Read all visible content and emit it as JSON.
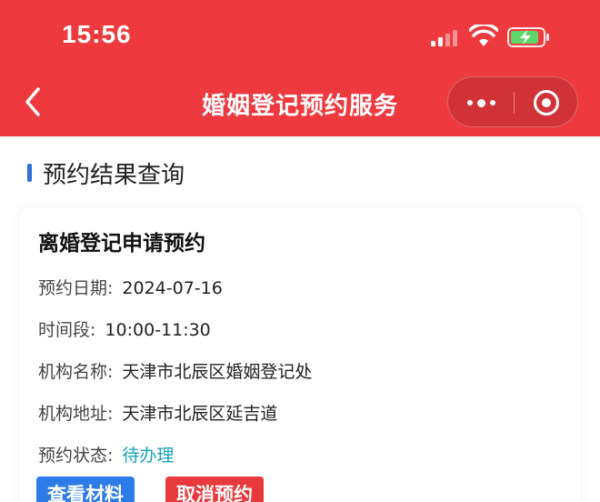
{
  "status_bar": {
    "time": "15:56"
  },
  "nav": {
    "title": "婚姻登记预约服务"
  },
  "section": {
    "title": "预约结果查询"
  },
  "appointment": {
    "title": "离婚登记申请预约",
    "fields": [
      {
        "label": "预约日期:",
        "value": "2024-07-16"
      },
      {
        "label": "时间段:",
        "value": "10:00-11:30"
      },
      {
        "label": "机构名称:",
        "value": "天津市北辰区婚姻登记处"
      },
      {
        "label": "机构地址:",
        "value": "天津市北辰区延吉道"
      },
      {
        "label": "预约状态:",
        "value": "待办理"
      }
    ],
    "buttons": {
      "view": "查看材料",
      "cancel": "取消预约"
    }
  },
  "colors": {
    "header": "#ee3a3f",
    "accent_blue": "#2d7be8",
    "status_teal": "#17a2b8",
    "cancel_red": "#e8393c"
  },
  "icons": [
    "back-chevron-icon",
    "cellular-signal-icon",
    "wifi-icon",
    "battery-charging-icon",
    "more-dots-icon",
    "close-target-icon"
  ]
}
